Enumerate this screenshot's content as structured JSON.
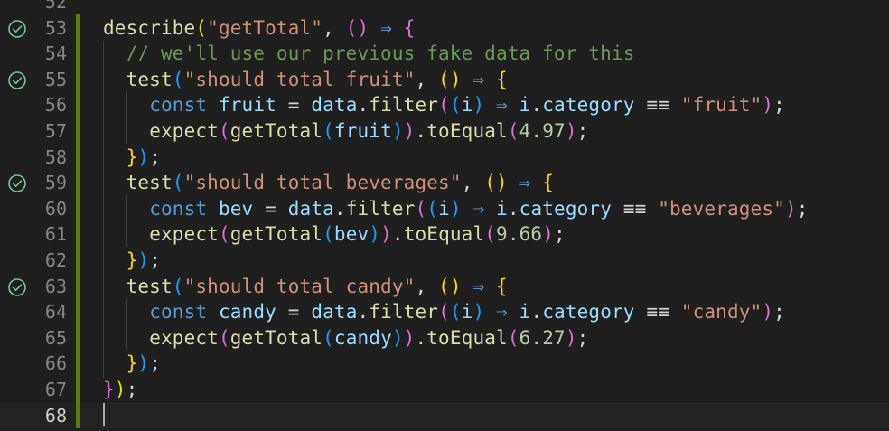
{
  "editor": {
    "lines": [
      {
        "number": "52",
        "passed": false,
        "tokens": []
      },
      {
        "number": "53",
        "passed": true,
        "tokens": [
          {
            "t": "describe",
            "c": "fn"
          },
          {
            "t": "(",
            "c": "p1"
          },
          {
            "t": "\"getTotal\"",
            "c": "str"
          },
          {
            "t": ", ",
            "c": "op"
          },
          {
            "t": "()",
            "c": "p2"
          },
          {
            "t": " ⇒ ",
            "c": "kw"
          },
          {
            "t": "{",
            "c": "p2"
          }
        ]
      },
      {
        "number": "54",
        "passed": false,
        "tokens": [
          {
            "t": "  // we'll use our previous fake data for this",
            "c": "cm"
          }
        ]
      },
      {
        "number": "55",
        "passed": true,
        "tokens": [
          {
            "t": "  ",
            "c": "op"
          },
          {
            "t": "test",
            "c": "fn"
          },
          {
            "t": "(",
            "c": "p3"
          },
          {
            "t": "\"should total fruit\"",
            "c": "str"
          },
          {
            "t": ", ",
            "c": "op"
          },
          {
            "t": "()",
            "c": "p1"
          },
          {
            "t": " ⇒ ",
            "c": "kw"
          },
          {
            "t": "{",
            "c": "p1"
          }
        ]
      },
      {
        "number": "56",
        "passed": false,
        "tokens": [
          {
            "t": "    ",
            "c": "op"
          },
          {
            "t": "const",
            "c": "kw"
          },
          {
            "t": " ",
            "c": "op"
          },
          {
            "t": "fruit",
            "c": "var"
          },
          {
            "t": " = ",
            "c": "op"
          },
          {
            "t": "data",
            "c": "var"
          },
          {
            "t": ".",
            "c": "op"
          },
          {
            "t": "filter",
            "c": "fn"
          },
          {
            "t": "(",
            "c": "p2"
          },
          {
            "t": "(",
            "c": "p3"
          },
          {
            "t": "i",
            "c": "var"
          },
          {
            "t": ")",
            "c": "p3"
          },
          {
            "t": " ⇒ ",
            "c": "kw"
          },
          {
            "t": "i",
            "c": "var"
          },
          {
            "t": ".",
            "c": "op"
          },
          {
            "t": "category",
            "c": "var"
          },
          {
            "t": " ≡≡ ",
            "c": "op"
          },
          {
            "t": "\"fruit\"",
            "c": "str"
          },
          {
            "t": ")",
            "c": "p2"
          },
          {
            "t": ";",
            "c": "op"
          }
        ]
      },
      {
        "number": "57",
        "passed": false,
        "tokens": [
          {
            "t": "    ",
            "c": "op"
          },
          {
            "t": "expect",
            "c": "fn"
          },
          {
            "t": "(",
            "c": "p2"
          },
          {
            "t": "getTotal",
            "c": "fn"
          },
          {
            "t": "(",
            "c": "p3"
          },
          {
            "t": "fruit",
            "c": "var"
          },
          {
            "t": ")",
            "c": "p3"
          },
          {
            "t": ")",
            "c": "p2"
          },
          {
            "t": ".",
            "c": "op"
          },
          {
            "t": "toEqual",
            "c": "fn"
          },
          {
            "t": "(",
            "c": "p2"
          },
          {
            "t": "4.97",
            "c": "num"
          },
          {
            "t": ")",
            "c": "p2"
          },
          {
            "t": ";",
            "c": "op"
          }
        ]
      },
      {
        "number": "58",
        "passed": false,
        "tokens": [
          {
            "t": "  ",
            "c": "op"
          },
          {
            "t": "}",
            "c": "p1"
          },
          {
            "t": ")",
            "c": "p3"
          },
          {
            "t": ";",
            "c": "op"
          }
        ]
      },
      {
        "number": "59",
        "passed": true,
        "tokens": [
          {
            "t": "  ",
            "c": "op"
          },
          {
            "t": "test",
            "c": "fn"
          },
          {
            "t": "(",
            "c": "p3"
          },
          {
            "t": "\"should total beverages\"",
            "c": "str"
          },
          {
            "t": ", ",
            "c": "op"
          },
          {
            "t": "()",
            "c": "p1"
          },
          {
            "t": " ⇒ ",
            "c": "kw"
          },
          {
            "t": "{",
            "c": "p1"
          }
        ]
      },
      {
        "number": "60",
        "passed": false,
        "tokens": [
          {
            "t": "    ",
            "c": "op"
          },
          {
            "t": "const",
            "c": "kw"
          },
          {
            "t": " ",
            "c": "op"
          },
          {
            "t": "bev",
            "c": "var"
          },
          {
            "t": " = ",
            "c": "op"
          },
          {
            "t": "data",
            "c": "var"
          },
          {
            "t": ".",
            "c": "op"
          },
          {
            "t": "filter",
            "c": "fn"
          },
          {
            "t": "(",
            "c": "p2"
          },
          {
            "t": "(",
            "c": "p3"
          },
          {
            "t": "i",
            "c": "var"
          },
          {
            "t": ")",
            "c": "p3"
          },
          {
            "t": " ⇒ ",
            "c": "kw"
          },
          {
            "t": "i",
            "c": "var"
          },
          {
            "t": ".",
            "c": "op"
          },
          {
            "t": "category",
            "c": "var"
          },
          {
            "t": " ≡≡ ",
            "c": "op"
          },
          {
            "t": "\"beverages\"",
            "c": "str"
          },
          {
            "t": ")",
            "c": "p2"
          },
          {
            "t": ";",
            "c": "op"
          }
        ]
      },
      {
        "number": "61",
        "passed": false,
        "tokens": [
          {
            "t": "    ",
            "c": "op"
          },
          {
            "t": "expect",
            "c": "fn"
          },
          {
            "t": "(",
            "c": "p2"
          },
          {
            "t": "getTotal",
            "c": "fn"
          },
          {
            "t": "(",
            "c": "p3"
          },
          {
            "t": "bev",
            "c": "var"
          },
          {
            "t": ")",
            "c": "p3"
          },
          {
            "t": ")",
            "c": "p2"
          },
          {
            "t": ".",
            "c": "op"
          },
          {
            "t": "toEqual",
            "c": "fn"
          },
          {
            "t": "(",
            "c": "p2"
          },
          {
            "t": "9.66",
            "c": "num"
          },
          {
            "t": ")",
            "c": "p2"
          },
          {
            "t": ";",
            "c": "op"
          }
        ]
      },
      {
        "number": "62",
        "passed": false,
        "tokens": [
          {
            "t": "  ",
            "c": "op"
          },
          {
            "t": "}",
            "c": "p1"
          },
          {
            "t": ")",
            "c": "p3"
          },
          {
            "t": ";",
            "c": "op"
          }
        ]
      },
      {
        "number": "63",
        "passed": true,
        "tokens": [
          {
            "t": "  ",
            "c": "op"
          },
          {
            "t": "test",
            "c": "fn"
          },
          {
            "t": "(",
            "c": "p3"
          },
          {
            "t": "\"should total candy\"",
            "c": "str"
          },
          {
            "t": ", ",
            "c": "op"
          },
          {
            "t": "()",
            "c": "p1"
          },
          {
            "t": " ⇒ ",
            "c": "kw"
          },
          {
            "t": "{",
            "c": "p1"
          }
        ]
      },
      {
        "number": "64",
        "passed": false,
        "tokens": [
          {
            "t": "    ",
            "c": "op"
          },
          {
            "t": "const",
            "c": "kw"
          },
          {
            "t": " ",
            "c": "op"
          },
          {
            "t": "candy",
            "c": "var"
          },
          {
            "t": " = ",
            "c": "op"
          },
          {
            "t": "data",
            "c": "var"
          },
          {
            "t": ".",
            "c": "op"
          },
          {
            "t": "filter",
            "c": "fn"
          },
          {
            "t": "(",
            "c": "p2"
          },
          {
            "t": "(",
            "c": "p3"
          },
          {
            "t": "i",
            "c": "var"
          },
          {
            "t": ")",
            "c": "p3"
          },
          {
            "t": " ⇒ ",
            "c": "kw"
          },
          {
            "t": "i",
            "c": "var"
          },
          {
            "t": ".",
            "c": "op"
          },
          {
            "t": "category",
            "c": "var"
          },
          {
            "t": " ≡≡ ",
            "c": "op"
          },
          {
            "t": "\"candy\"",
            "c": "str"
          },
          {
            "t": ")",
            "c": "p2"
          },
          {
            "t": ";",
            "c": "op"
          }
        ]
      },
      {
        "number": "65",
        "passed": false,
        "tokens": [
          {
            "t": "    ",
            "c": "op"
          },
          {
            "t": "expect",
            "c": "fn"
          },
          {
            "t": "(",
            "c": "p2"
          },
          {
            "t": "getTotal",
            "c": "fn"
          },
          {
            "t": "(",
            "c": "p3"
          },
          {
            "t": "candy",
            "c": "var"
          },
          {
            "t": ")",
            "c": "p3"
          },
          {
            "t": ")",
            "c": "p2"
          },
          {
            "t": ".",
            "c": "op"
          },
          {
            "t": "toEqual",
            "c": "fn"
          },
          {
            "t": "(",
            "c": "p2"
          },
          {
            "t": "6.27",
            "c": "num"
          },
          {
            "t": ")",
            "c": "p2"
          },
          {
            "t": ";",
            "c": "op"
          }
        ]
      },
      {
        "number": "66",
        "passed": false,
        "tokens": [
          {
            "t": "  ",
            "c": "op"
          },
          {
            "t": "}",
            "c": "p1"
          },
          {
            "t": ")",
            "c": "p3"
          },
          {
            "t": ";",
            "c": "op"
          }
        ]
      },
      {
        "number": "67",
        "passed": false,
        "tokens": [
          {
            "t": "}",
            "c": "p2"
          },
          {
            "t": ")",
            "c": "p1"
          },
          {
            "t": ";",
            "c": "op"
          }
        ]
      },
      {
        "number": "68",
        "passed": false,
        "current": true,
        "tokens": []
      }
    ],
    "colors": {
      "background": "#1f1f1f",
      "line_number": "#858585",
      "active_line_number": "#cccccc",
      "test_passed": "#73c991",
      "modified_gutter": "#587c0c"
    }
  }
}
